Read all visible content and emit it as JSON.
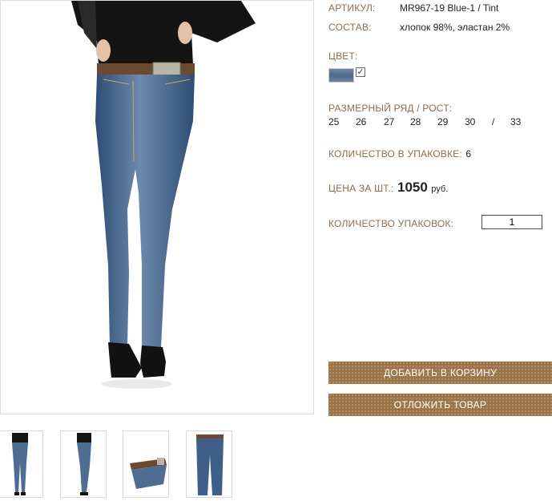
{
  "product": {
    "article_label": "АРТИКУЛ:",
    "article_value": "MR967-19 Blue-1 / Tint",
    "composition_label": "СОСТАВ:",
    "composition_value": "хлопок 98%, эластан 2%",
    "color_label": "ЦВЕТ:",
    "color_swatch": "#5e7898",
    "color_checkbox_checked": true,
    "sizes_label": "РАЗМЕРНЫЙ РЯД / РОСТ:",
    "sizes": [
      "25",
      "26",
      "27",
      "28",
      "29",
      "30",
      "/",
      "33"
    ],
    "pack_qty_label": "КОЛИЧЕСТВО В УПАКОВКЕ:",
    "pack_qty_value": "6",
    "price_label": "ЦЕНА ЗА ШТ.:",
    "price_value": "1050",
    "price_currency": "руб.",
    "packs_label": "КОЛИЧЕСТВО УПАКОВОК:",
    "packs_value": "1"
  },
  "buttons": {
    "add_to_cart": "ДОБАВИТЬ В КОРЗИНУ",
    "save_item": "ОТЛОЖИТЬ ТОВАР"
  },
  "colors": {
    "label_color": "#8b6e4e",
    "button_color": "#9a7446",
    "denim": "#4f6d93"
  },
  "thumbnails": [
    "front-view",
    "side-view",
    "waist-detail",
    "flat-lay"
  ]
}
